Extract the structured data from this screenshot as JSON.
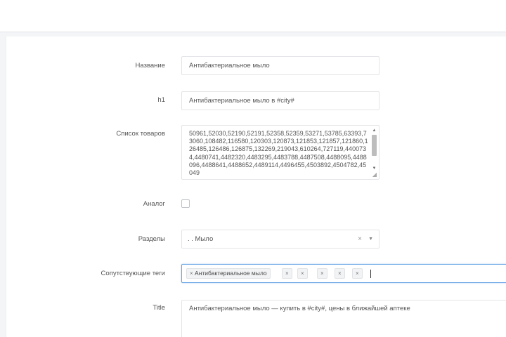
{
  "form": {
    "name": {
      "label": "Название",
      "value": "Антибактериальное мыло"
    },
    "h1": {
      "label": "h1",
      "value": "Антибактериальное мыло в #city#"
    },
    "products": {
      "label": "Список товаров",
      "value": "50961,52030,52190,52191,52358,52359,53271,53785,63393,73060,108482,116580,120303,120873,121853,121857,121860,126485,126486,126875,132269,219043,610264,727119,4400734,4480741,4482320,4483295,4483788,4487508,4488095,4488096,4488641,4488652,4489114,4496455,4503892,4504782,45049"
    },
    "analog": {
      "label": "Аналог",
      "checked": false
    },
    "sections": {
      "label": "Разделы",
      "value": ". . Мыло",
      "clear": "×",
      "arrow": "▼"
    },
    "tags": {
      "label": "Сопутствующие теги",
      "items": [
        {
          "x": "×",
          "text": "Антибактериальное мыло",
          "x2": "×"
        },
        {
          "x": "×",
          "text": ""
        },
        {
          "x": "×",
          "text": ""
        },
        {
          "x": "×",
          "text": ""
        },
        {
          "x": "×",
          "text": ""
        }
      ]
    },
    "title": {
      "label": "Title",
      "value": "Антибактериальное мыло — купить в #city#, цены в ближайшей аптеке"
    }
  },
  "icons": {
    "scroll_up": "▲",
    "scroll_down": "▼",
    "resize": "◢"
  }
}
